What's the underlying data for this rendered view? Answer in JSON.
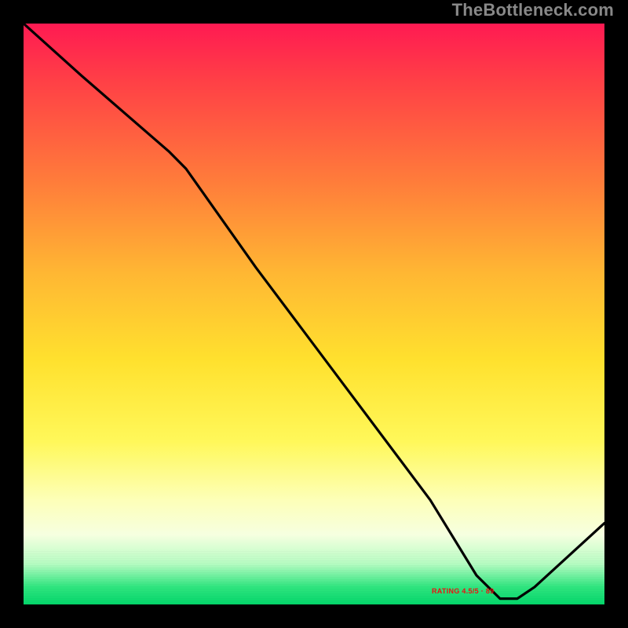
{
  "watermark": "TheBottleneck.com",
  "bottom_label": "RATING 4.5/5 · 89",
  "colors": {
    "page_bg": "#000000",
    "gradient_top": "#ff1a52",
    "gradient_mid": "#ffe12e",
    "gradient_bottom": "#03d66a",
    "curve": "#000000",
    "watermark": "#888888",
    "bottom_label": "#ee1111"
  },
  "chart_data": {
    "type": "line",
    "title": "",
    "xlabel": "",
    "ylabel": "",
    "xlim": [
      0,
      100
    ],
    "ylim": [
      0,
      100
    ],
    "series": [
      {
        "name": "curve",
        "x": [
          0,
          10,
          25,
          28,
          40,
          55,
          70,
          78,
          82,
          85,
          88,
          100
        ],
        "y": [
          100,
          91,
          78,
          75,
          58,
          38,
          18,
          5,
          1,
          1,
          3,
          14
        ]
      }
    ],
    "annotations": [
      {
        "text": "RATING 4.5/5 · 89",
        "x": 82,
        "y": 1
      }
    ],
    "notes": "Background is a vertical heat gradient (red→yellow→green). Curve is a black line from top-left descending to a flat minimum around x≈82–85 near y≈1, then rising toward the right edge."
  }
}
